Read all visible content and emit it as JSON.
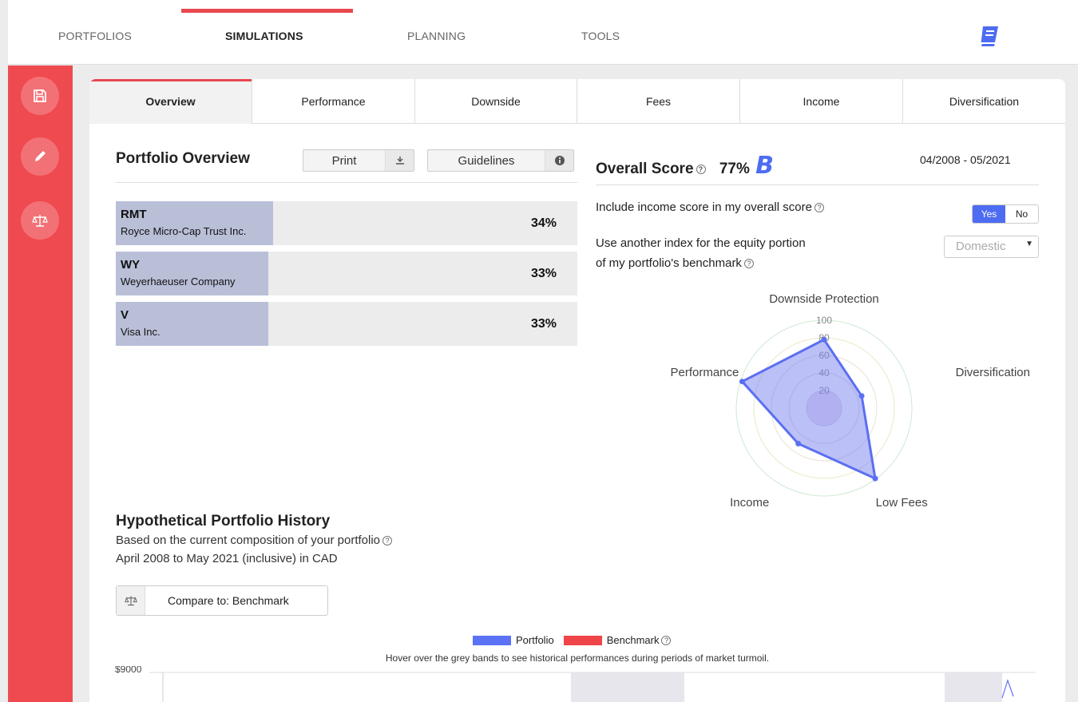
{
  "nav": {
    "items": [
      "PORTFOLIOS",
      "SIMULATIONS",
      "PLANNING",
      "TOOLS"
    ],
    "active": "SIMULATIONS"
  },
  "sidebar": {
    "icons": [
      "save-icon",
      "pencil-icon",
      "balance-scale-icon"
    ]
  },
  "tabs": [
    "Overview",
    "Performance",
    "Downside",
    "Fees",
    "Income",
    "Diversification"
  ],
  "overview": {
    "title": "Portfolio Overview",
    "print_label": "Print",
    "guidelines_label": "Guidelines",
    "holdings": [
      {
        "ticker": "RMT",
        "name": "Royce Micro-Cap Trust Inc.",
        "weight": "34%",
        "weight_value": 34
      },
      {
        "ticker": "WY",
        "name": "Weyerhaeuser Company",
        "weight": "33%",
        "weight_value": 33
      },
      {
        "ticker": "V",
        "name": "Visa Inc.",
        "weight": "33%",
        "weight_value": 33
      }
    ]
  },
  "score": {
    "title": "Overall Score",
    "percent": "77%",
    "grade": "B",
    "date_range": "04/2008 - 05/2021",
    "income_label": "Include income score in my overall score",
    "toggle_yes": "Yes",
    "toggle_no": "No",
    "toggle_selected": "Yes",
    "index_label_1": "Use another index for the equity portion",
    "index_label_2": "of my portfolio's benchmark",
    "index_value": "Domestic"
  },
  "chart_data": [
    {
      "type": "radar",
      "axes": [
        "Downside Protection",
        "Diversification",
        "Low Fees",
        "Income",
        "Performance"
      ],
      "ticks": [
        "100",
        "80",
        "60",
        "40",
        "20"
      ],
      "range": [
        0,
        100
      ],
      "series": [
        {
          "values": [
            78,
            45,
            99,
            50,
            98
          ]
        }
      ]
    }
  ],
  "history": {
    "title": "Hypothetical Portfolio History",
    "subtitle": "Based on the current composition of your portfolio",
    "range_text": "April 2008 to May 2021 (inclusive) in CAD",
    "compare_label": "Compare to: Benchmark",
    "legend": [
      {
        "name": "Portfolio",
        "color": "#5b72f5"
      },
      {
        "name": "Benchmark",
        "color": "#ef4448"
      }
    ],
    "note": "Hover over the grey bands to see historical performances during periods of market turmoil.",
    "y_tick": "$9000"
  },
  "colors": {
    "accent": "#ef4a4f",
    "brand_blue": "#4e6cf2"
  }
}
